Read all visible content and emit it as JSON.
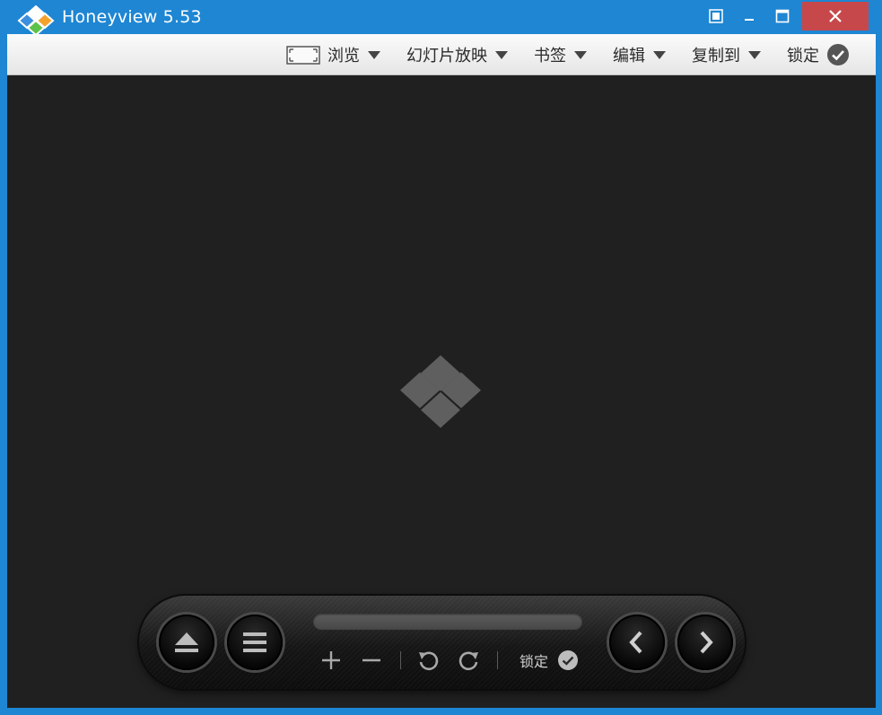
{
  "window": {
    "title": "Honeyview 5.53"
  },
  "menu": {
    "items": [
      {
        "label": "浏览",
        "icon": "fit-to-window-icon",
        "dropdown": true
      },
      {
        "label": "幻灯片放映",
        "dropdown": true
      },
      {
        "label": "书签",
        "dropdown": true
      },
      {
        "label": "编辑",
        "dropdown": true
      },
      {
        "label": "复制到",
        "dropdown": true
      },
      {
        "label": "锁定",
        "icon": "check-circle-icon",
        "dropdown": false
      }
    ]
  },
  "controls": {
    "buttons": [
      "eject-icon",
      "menu-icon",
      "zoom-in-icon",
      "zoom-out-icon",
      "rotate-left-icon",
      "rotate-right-icon",
      "previous-icon",
      "next-icon"
    ],
    "lock_label": "锁定",
    "progress": 0
  },
  "colors": {
    "titlebar": "#1e86d3",
    "close": "#c7484b",
    "viewer_bg": "#202020",
    "logo_gray": "#5f5f5f"
  }
}
